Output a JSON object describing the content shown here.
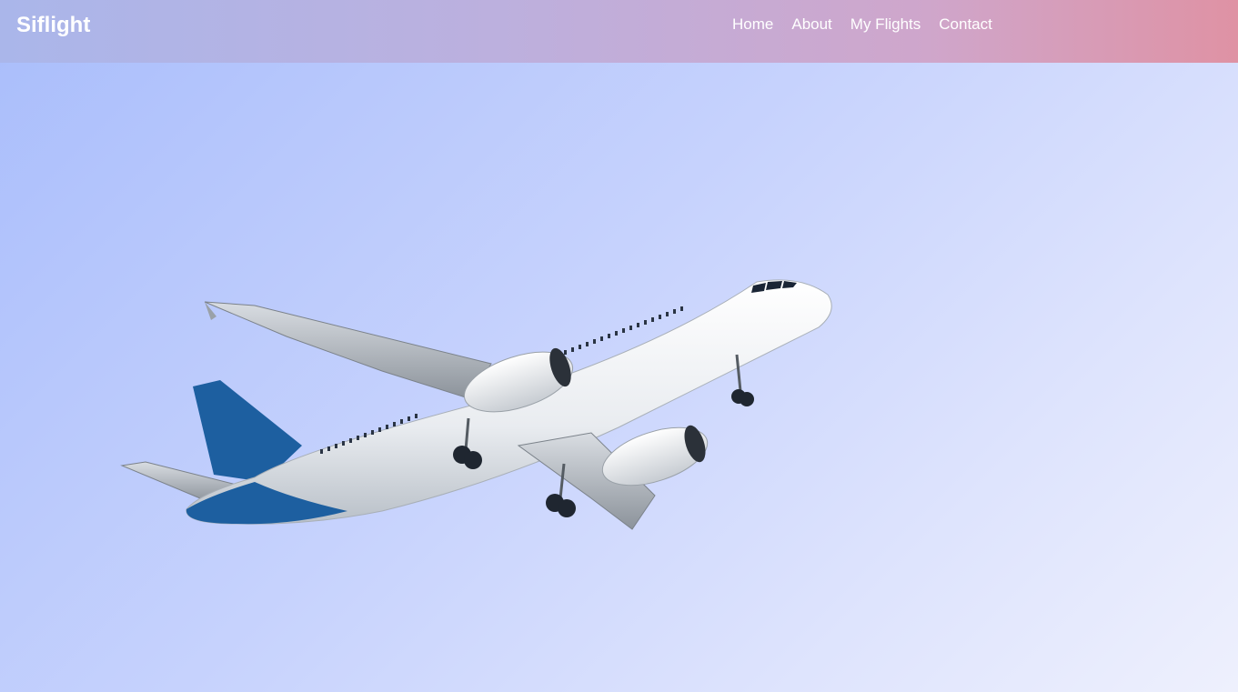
{
  "brand": {
    "name": "Siflight"
  },
  "nav": {
    "items": [
      {
        "label": "Home"
      },
      {
        "label": "About"
      },
      {
        "label": "My Flights"
      },
      {
        "label": "Contact"
      }
    ]
  },
  "hero": {
    "image": "airplane-in-sky"
  },
  "colors": {
    "nav_gradient_start": "#aab6ea",
    "nav_gradient_end": "#df92a4",
    "page_gradient_start": "#a9bdfb",
    "page_gradient_end": "#eef0fd",
    "tail_blue": "#1d5fa0"
  }
}
